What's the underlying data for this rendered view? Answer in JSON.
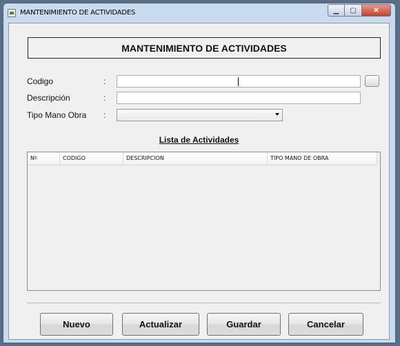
{
  "window": {
    "title": "MANTENIMIENTO DE ACTIVIDADES"
  },
  "form": {
    "header": "MANTENIMIENTO DE ACTIVIDADES",
    "codigo_label": "Codigo",
    "descripcion_label": "Descripción",
    "tipo_label": "Tipo Mano Obra",
    "colon": ":",
    "codigo_value": "",
    "descripcion_value": "",
    "tipo_value": ""
  },
  "list": {
    "title": "Lista de Actividades",
    "columns": [
      "Nº",
      "CODIGO",
      "DESCRIPCION",
      "TIPO MANO DE OBRA"
    ],
    "rows": []
  },
  "buttons": {
    "nuevo": "Nuevo",
    "actualizar": "Actualizar",
    "guardar": "Guardar",
    "cancelar": "Cancelar"
  },
  "icons": {
    "app": "app-window-icon",
    "minimize": "minimize-icon",
    "maximize": "maximize-icon",
    "close": "close-icon",
    "dropdown": "chevron-down-icon"
  }
}
